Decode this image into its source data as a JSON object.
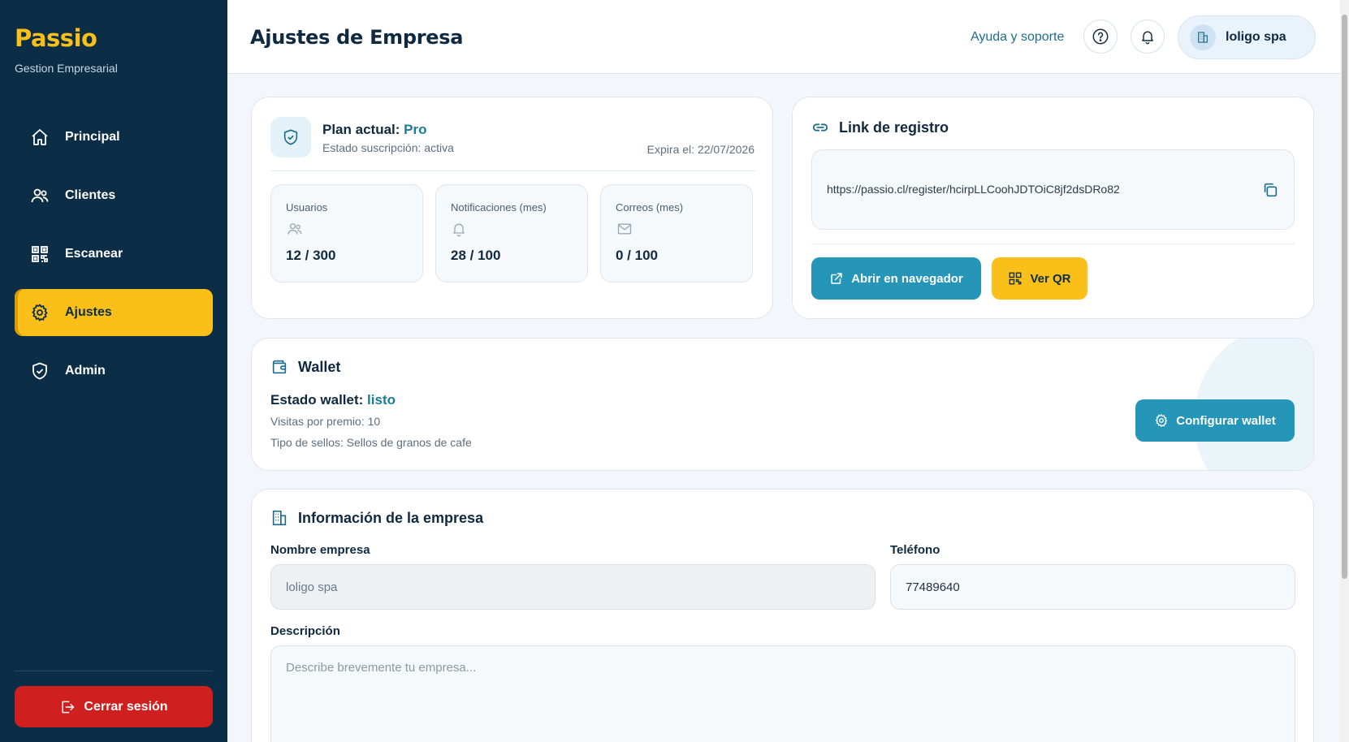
{
  "sidebar": {
    "brand": "Passio",
    "brand_subtitle": "Gestion Empresarial",
    "items": [
      {
        "label": "Principal",
        "icon": "home-icon"
      },
      {
        "label": "Clientes",
        "icon": "users-icon"
      },
      {
        "label": "Escanear",
        "icon": "qr-icon"
      },
      {
        "label": "Ajustes",
        "icon": "gear-icon",
        "active": true
      },
      {
        "label": "Admin",
        "icon": "shield-icon"
      }
    ],
    "logout_label": "Cerrar sesión"
  },
  "header": {
    "title": "Ajustes de Empresa",
    "help_link": "Ayuda y soporte",
    "company_name": "loligo spa"
  },
  "plan": {
    "title_prefix": "Plan actual:",
    "plan_name": "Pro",
    "status": "Estado suscripción: activa",
    "expires": "Expira el: 22/07/2026",
    "stats": [
      {
        "label": "Usuarios",
        "value": "12 / 300",
        "icon": "users-icon"
      },
      {
        "label": "Notificaciones (mes)",
        "value": "28 / 100",
        "icon": "bell-icon"
      },
      {
        "label": "Correos (mes)",
        "value": "0 / 100",
        "icon": "mail-icon"
      }
    ]
  },
  "registration": {
    "title": "Link de registro",
    "url": "https://passio.cl/register/hcirpLLCoohJDTOiC8jf2dsDRo82",
    "open_button": "Abrir en navegador",
    "qr_button": "Ver QR"
  },
  "wallet": {
    "title": "Wallet",
    "state_prefix": "Estado wallet:",
    "state_value": "listo",
    "visits": "Visitas por premio: 10",
    "stamps": "Tipo de sellos: Sellos de granos de cafe",
    "configure_button": "Configurar wallet"
  },
  "company_info": {
    "title": "Información de la empresa",
    "name_label": "Nombre empresa",
    "name_value": "loligo spa",
    "phone_label": "Teléfono",
    "phone_value": "77489640",
    "description_label": "Descripción",
    "description_placeholder": "Describe brevemente tu empresa..."
  },
  "colors": {
    "sidebar_bg": "#0b2d45",
    "accent_yellow": "#fbbf1a",
    "accent_teal": "#2596b8",
    "danger": "#d01f1f"
  }
}
